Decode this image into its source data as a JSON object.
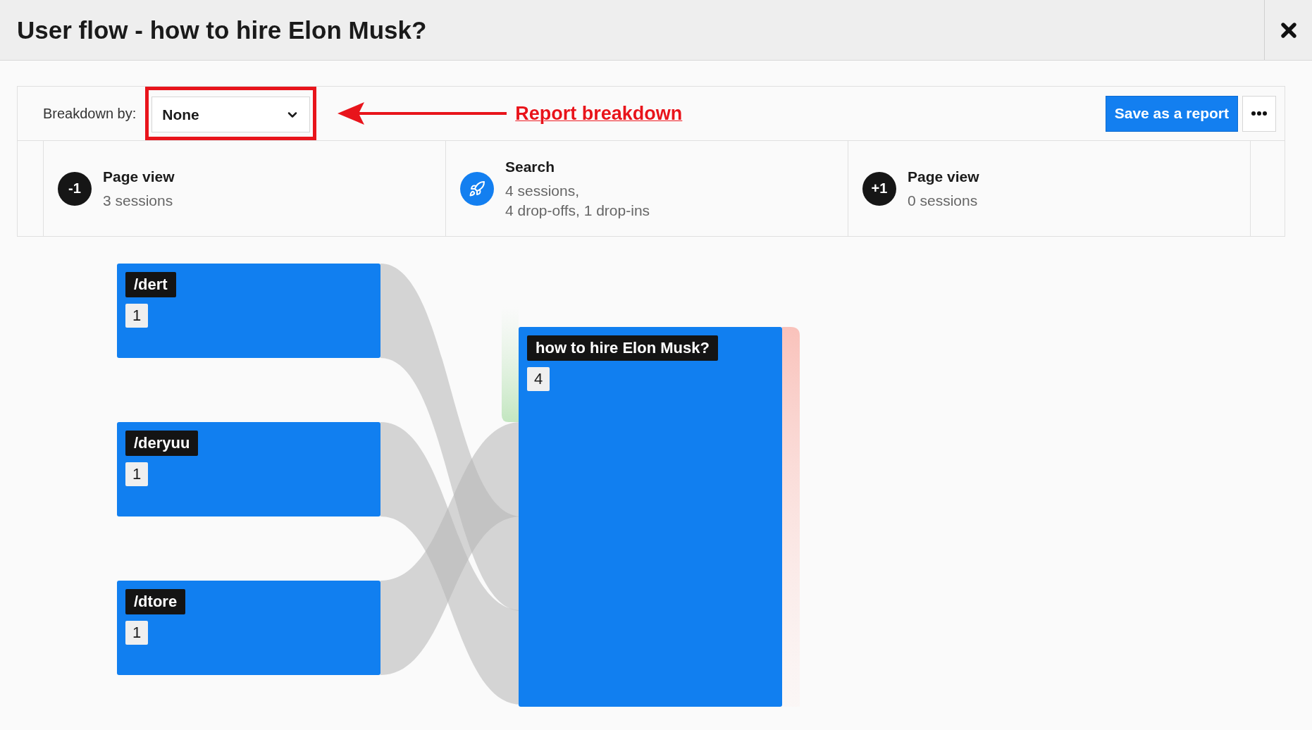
{
  "window": {
    "title": "User flow - how to hire Elon Musk?"
  },
  "toolbar": {
    "breakdown_label": "Breakdown by:",
    "breakdown_value": "None",
    "annotation": "Report breakdown",
    "save_button": "Save as a report"
  },
  "steps": [
    {
      "kind": "badge",
      "badge": "-1",
      "title": "Page view",
      "lines": [
        "3 sessions"
      ]
    },
    {
      "kind": "icon",
      "title": "Search",
      "lines": [
        "4 sessions,",
        "4 drop-offs, 1 drop-ins"
      ]
    },
    {
      "kind": "badge",
      "badge": "+1",
      "title": "Page view",
      "lines": [
        "0 sessions"
      ]
    }
  ],
  "flow": {
    "sources": [
      {
        "label": "/dert",
        "count": "1"
      },
      {
        "label": "/deryuu",
        "count": "1"
      },
      {
        "label": "/dtore",
        "count": "1"
      }
    ],
    "target": {
      "label": "how to hire Elon Musk?",
      "count": "4"
    }
  }
}
